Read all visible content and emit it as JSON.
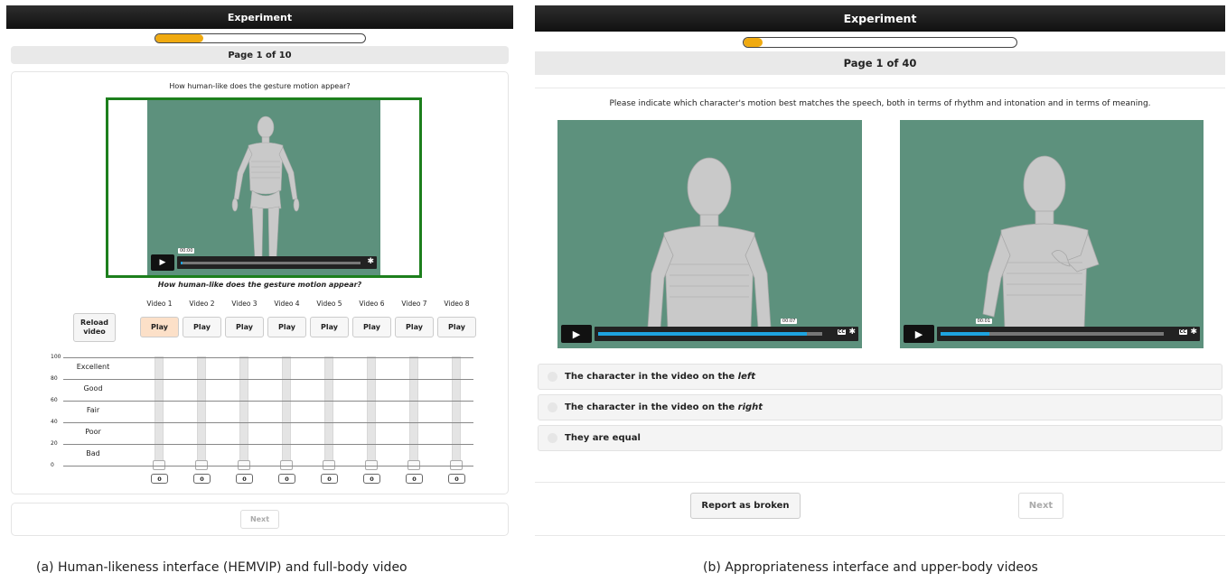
{
  "left": {
    "title": "Experiment",
    "progress_fraction": 0.23,
    "page": "Page 1 of 10",
    "question": "How human-like does the gesture motion appear?",
    "video_time": "00:00",
    "video_progress": 0.01,
    "subquestion": "How human-like does the gesture motion appear?",
    "reload_line1": "Reload",
    "reload_line2": "video",
    "videos": [
      {
        "label": "Video 1",
        "play": "Play",
        "value": "0"
      },
      {
        "label": "Video 2",
        "play": "Play",
        "value": "0"
      },
      {
        "label": "Video 3",
        "play": "Play",
        "value": "0"
      },
      {
        "label": "Video 4",
        "play": "Play",
        "value": "0"
      },
      {
        "label": "Video 5",
        "play": "Play",
        "value": "0"
      },
      {
        "label": "Video 6",
        "play": "Play",
        "value": "0"
      },
      {
        "label": "Video 7",
        "play": "Play",
        "value": "0"
      },
      {
        "label": "Video 8",
        "play": "Play",
        "value": "0"
      }
    ],
    "scale_numbers": [
      "100",
      "80",
      "60",
      "40",
      "20",
      "0"
    ],
    "scale_words": [
      "Excellent",
      "Good",
      "Fair",
      "Poor",
      "Bad"
    ],
    "next": "Next"
  },
  "right": {
    "title": "Experiment",
    "progress_fraction": 0.07,
    "page": "Page 1 of 40",
    "question": "Please indicate which character's motion best matches the speech, both in terms of rhythm and intonation and in terms of meaning.",
    "video1_time": "00:07",
    "video1_progress": 0.93,
    "video2_time": "00:01",
    "video2_progress": 0.22,
    "cc": "CC",
    "options": [
      {
        "prefix": "The character in the video on the ",
        "emph": "left"
      },
      {
        "prefix": "The character in the video on the ",
        "emph": "right"
      },
      {
        "prefix": "They are equal",
        "emph": ""
      }
    ],
    "report": "Report as broken",
    "next": "Next"
  },
  "captions": {
    "a": "(a) Human-likeness interface (HEMVIP) and full-body video",
    "b": "(b) Appropriateness interface and upper-body videos"
  },
  "colors": {
    "progress": "#f0aa10",
    "frame": "#1d7f1d",
    "video_bg": "#5d917d",
    "seek": "#1ea4e0"
  },
  "icons": [
    "play-icon",
    "gear-icon",
    "radio-icon"
  ]
}
